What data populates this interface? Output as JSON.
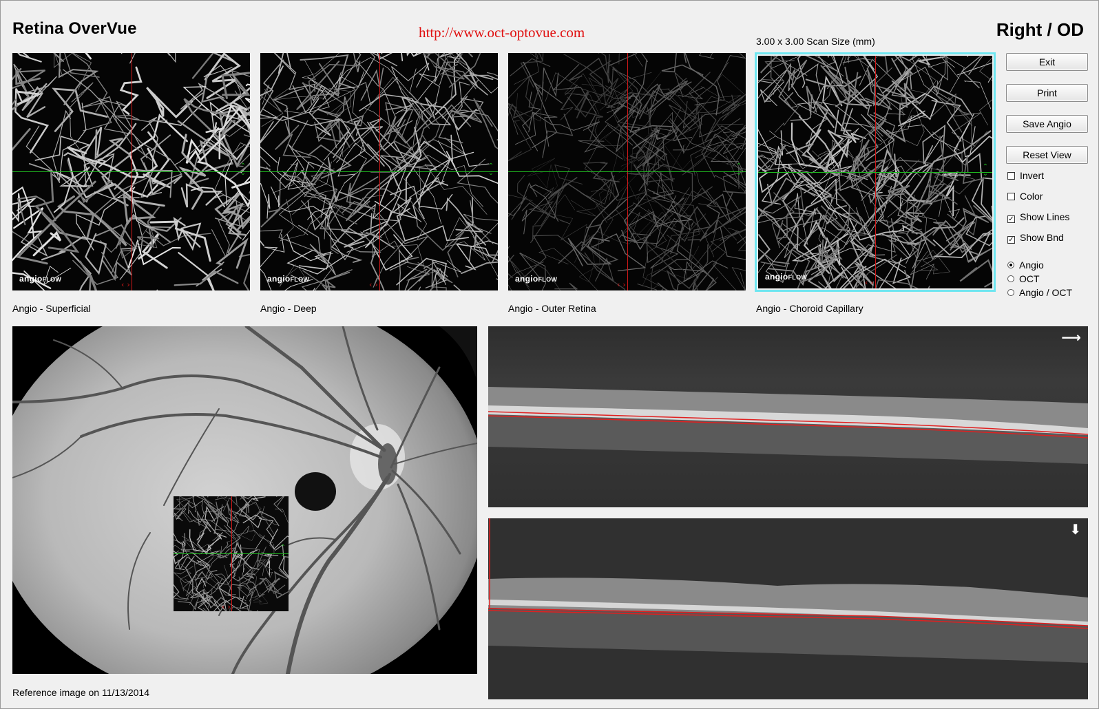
{
  "header": {
    "app_title": "Retina OverVue",
    "site_url": "http://www.oct-optovue.com",
    "eye": "Right / OD",
    "scan_size": "3.00 x 3.00 Scan Size (mm)"
  },
  "angio_panels": [
    {
      "caption": "Angio - Superficial",
      "brand": "angio",
      "brand_suffix": "FLOW",
      "selected": false
    },
    {
      "caption": "Angio - Deep",
      "brand": "angio",
      "brand_suffix": "FLOW",
      "selected": false
    },
    {
      "caption": "Angio - Outer Retina",
      "brand": "angio",
      "brand_suffix": "FLOW",
      "selected": false
    },
    {
      "caption": "Angio - Choroid Capillary",
      "brand": "angio",
      "brand_suffix": "FLOW",
      "selected": true
    }
  ],
  "controls": {
    "exit": "Exit",
    "print": "Print",
    "save_angio": "Save Angio",
    "reset_view": "Reset View",
    "checkboxes": [
      {
        "label": "Invert",
        "checked": false
      },
      {
        "label": "Color",
        "checked": false
      },
      {
        "label": "Show Lines",
        "checked": true
      },
      {
        "label": "Show Bnd",
        "checked": true
      }
    ],
    "radios": [
      {
        "label": "Angio",
        "selected": true
      },
      {
        "label": "OCT",
        "selected": false
      },
      {
        "label": "Angio / OCT",
        "selected": false
      }
    ]
  },
  "reference": {
    "caption": "Reference image on 11/13/2014"
  },
  "bscans": {
    "top_arrow": "⟶",
    "bottom_arrow": "⬇"
  },
  "colors": {
    "crosshair_vertical": "#d01818",
    "crosshair_horizontal": "#1fb81f",
    "selection_outline": "#6fe6f0",
    "url_text": "#e01010"
  }
}
